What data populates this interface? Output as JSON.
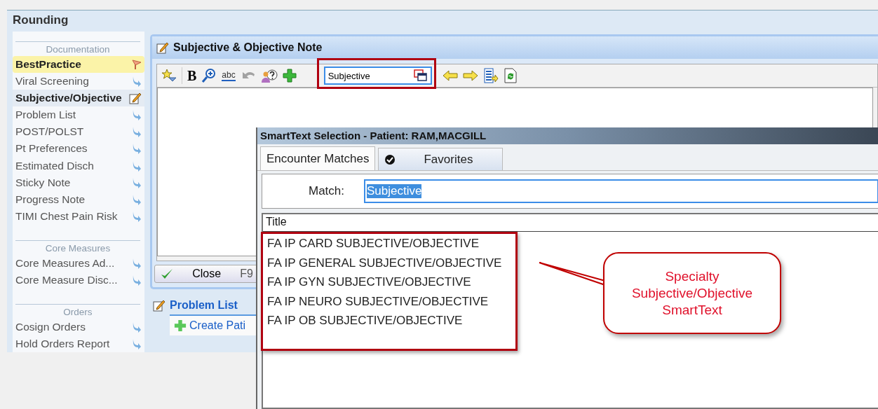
{
  "window": {
    "title": "Rounding"
  },
  "sidebar": {
    "sections": [
      {
        "heading": "Documentation",
        "items": [
          {
            "label": "BestPractice",
            "kind": "flag",
            "selected": false
          },
          {
            "label": "Viral Screening",
            "kind": "link",
            "selected": false
          },
          {
            "label": "Subjective/Objective",
            "kind": "edit",
            "selected": true
          },
          {
            "label": "Problem List",
            "kind": "link",
            "selected": false
          },
          {
            "label": "POST/POLST",
            "kind": "link",
            "selected": false
          },
          {
            "label": "Pt Preferences",
            "kind": "link",
            "selected": false
          },
          {
            "label": "Estimated Disch",
            "kind": "link",
            "selected": false
          },
          {
            "label": "Sticky Note",
            "kind": "link",
            "selected": false
          },
          {
            "label": "Progress Note",
            "kind": "link",
            "selected": false
          },
          {
            "label": "TIMI Chest Pain Risk",
            "kind": "link",
            "selected": false
          }
        ]
      },
      {
        "heading": "Core Measures",
        "items": [
          {
            "label": "Core Measures Ad...",
            "kind": "link",
            "selected": false
          },
          {
            "label": "Core Measure Disc...",
            "kind": "link",
            "selected": false
          }
        ]
      },
      {
        "heading": "Orders",
        "items": [
          {
            "label": "Cosign Orders",
            "kind": "link",
            "selected": false
          },
          {
            "label": "Hold Orders Report",
            "kind": "link",
            "selected": false
          }
        ]
      }
    ]
  },
  "note": {
    "title": "Subjective & Objective Note",
    "toolbar_left": [
      {
        "kind": "star",
        "disabled": false
      },
      {
        "kind": "bold",
        "label": "B",
        "disabled": false
      },
      {
        "kind": "zoom",
        "disabled": false
      },
      {
        "kind": "spell",
        "label": "abc",
        "disabled": false
      },
      {
        "kind": "undo",
        "disabled": true
      },
      {
        "kind": "help",
        "disabled": false
      },
      {
        "kind": "add",
        "disabled": false
      }
    ],
    "smarttext_field": {
      "value": "Subjective"
    },
    "toolbar_right": [
      {
        "kind": "prev",
        "disabled": false
      },
      {
        "kind": "next",
        "disabled": false
      },
      {
        "kind": "insert",
        "disabled": false
      },
      {
        "kind": "refresh",
        "disabled": false
      }
    ],
    "close_button": {
      "label": "Close",
      "shortcut": "F9"
    }
  },
  "problem_list": {
    "title": "Problem List",
    "create_button": "Create Pati"
  },
  "dialog": {
    "title": "SmartText Selection - Patient:  RAM,MACGILL",
    "tabs": [
      {
        "label": "Encounter Matches",
        "selected": true,
        "kind": "plain"
      },
      {
        "label": "Favorites",
        "selected": false,
        "kind": "check"
      }
    ],
    "match_label": "Match:",
    "match_value": "Subjective",
    "column": "Title",
    "rows": [
      "FA IP CARD SUBJECTIVE/OBJECTIVE",
      "FA IP GENERAL SUBJECTIVE/OBJECTIVE",
      "FA IP GYN SUBJECTIVE/OBJECTIVE",
      "FA IP NEURO SUBJECTIVE/OBJECTIVE",
      "FA IP OB SUBJECTIVE/OBJECTIVE"
    ]
  },
  "callout": {
    "lines": [
      "Specialty",
      "Subjective/Objective",
      "SmartText"
    ]
  }
}
